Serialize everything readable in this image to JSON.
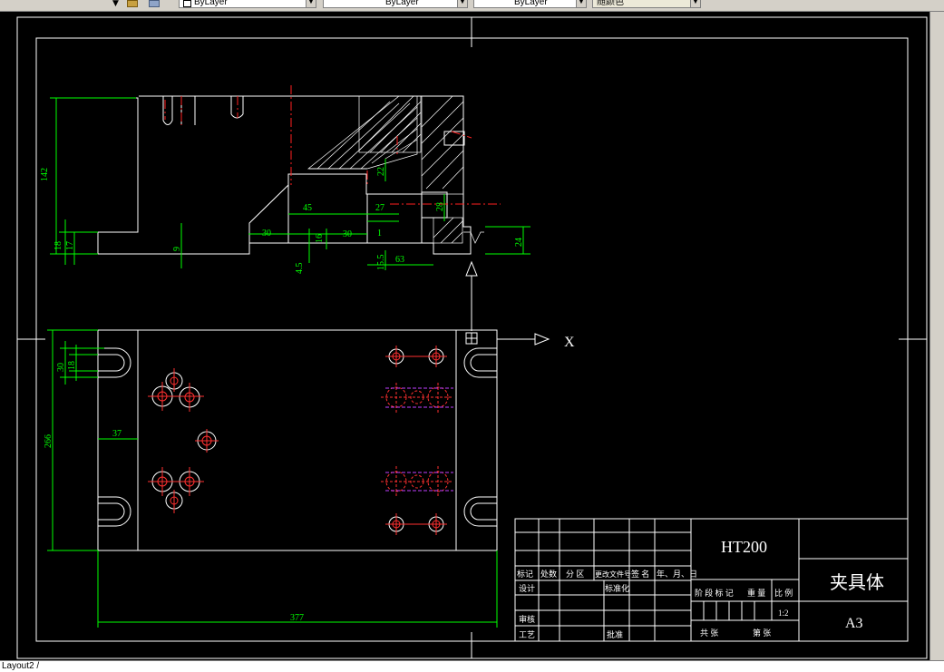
{
  "toolbar": {
    "color_value": "ByLayer",
    "linetype_value": "ByLayer",
    "lineweight_value": "ByLayer",
    "plotstyle_value": "随颜色"
  },
  "drawing": {
    "crosshair_x_label": "X",
    "dimensions": {
      "d142": "142",
      "d18": "18",
      "d17": "17",
      "d9": "9",
      "d30a": "30",
      "d45": "45",
      "d16": "16",
      "d30b": "30",
      "d4_5": "4.5",
      "d1": "1",
      "d27": "27",
      "d22": "22",
      "d28": "28",
      "d15_5": "15.5",
      "d63": "63",
      "d24": "24",
      "d30c": "30",
      "d18b": "18",
      "d37": "37",
      "d266": "266",
      "d377": "377"
    }
  },
  "title_block": {
    "material": "HT200",
    "part_name": "夹具体",
    "scale": "1:2",
    "sheet_size": "A3",
    "labels": {
      "mark": "标记",
      "count": "处数",
      "zone": "分 区",
      "change_doc": "更改文件号",
      "signature": "签 名",
      "date": "年、月、日",
      "design": "设计",
      "standardization": "标准化",
      "review": "审核",
      "process": "工艺",
      "approve": "批准",
      "stage_mark": "阶 段 标 记",
      "weight": "重 量",
      "ratio": "比 例",
      "total_sheets": "共     张",
      "sheet_no": "第     张"
    }
  },
  "command_line": {
    "text": "Layout2 /"
  }
}
